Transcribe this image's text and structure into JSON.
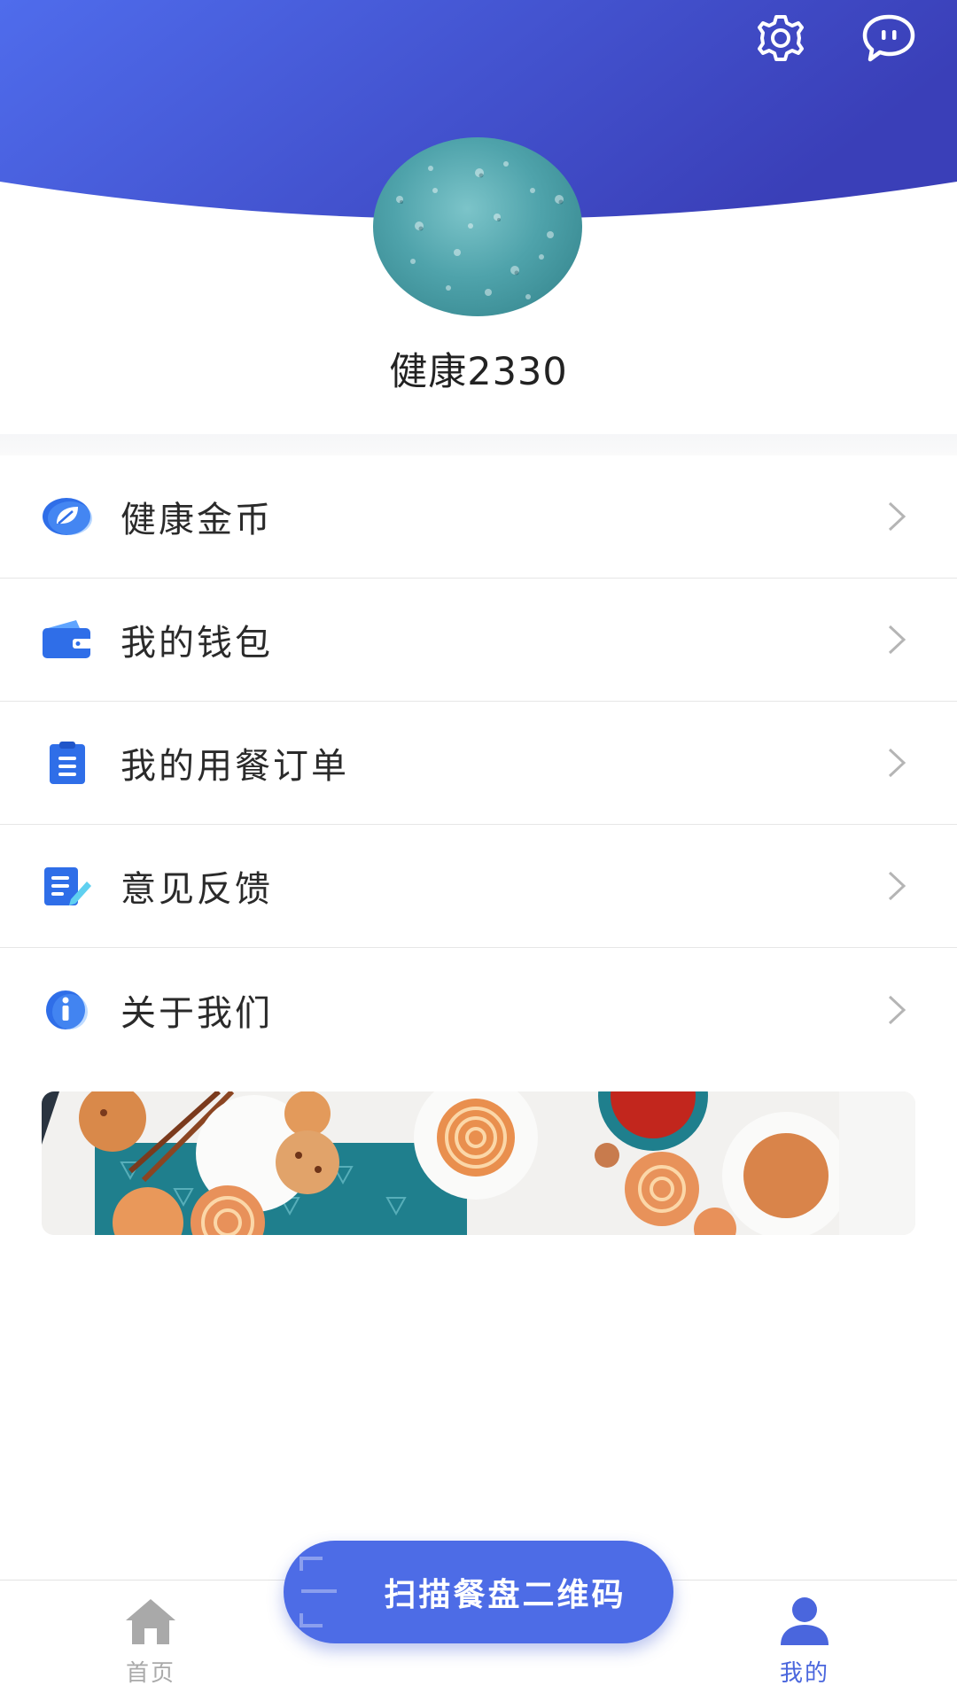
{
  "header": {
    "settings_icon": "gear-icon",
    "message_icon": "chat-bubble-icon",
    "gradient_start": "#4f6cec",
    "gradient_end": "#3a3fb8"
  },
  "profile": {
    "username": "健康2330"
  },
  "menu": {
    "items": [
      {
        "label": "健康金币",
        "icon": "leaf-coin-icon"
      },
      {
        "label": "我的钱包",
        "icon": "wallet-icon"
      },
      {
        "label": "我的用餐订单",
        "icon": "clipboard-icon"
      },
      {
        "label": "意见反馈",
        "icon": "feedback-edit-icon"
      },
      {
        "label": "关于我们",
        "icon": "info-icon"
      }
    ],
    "arrow_icon": "chevron-right-icon"
  },
  "scan": {
    "label": "扫描餐盘二维码"
  },
  "bottom_nav": {
    "items": [
      {
        "label": "首页",
        "icon": "home-icon",
        "active": false
      },
      {
        "label": "我的",
        "icon": "user-icon",
        "active": true
      }
    ],
    "active_color": "#4a66dd",
    "inactive_color": "#aaaaaa"
  },
  "colors": {
    "accent": "#4d6ce6",
    "icon_blue": "#2f6ee8"
  }
}
